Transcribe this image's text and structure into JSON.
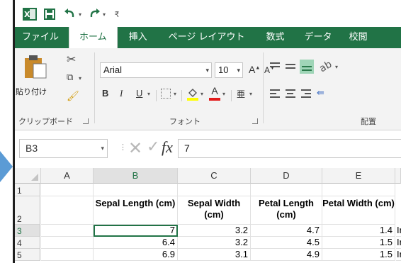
{
  "colors": {
    "accent": "#217346",
    "arrow": "#5b9bd5"
  },
  "quick_access": {
    "excel_icon": "excel-logo-icon",
    "save_icon": "save-icon",
    "undo_icon": "undo-icon",
    "redo_icon": "redo-icon",
    "customize_icon": "customize-quick-access-icon"
  },
  "tabs": [
    {
      "label": "ファイル"
    },
    {
      "label": "ホーム"
    },
    {
      "label": "挿入"
    },
    {
      "label": "ページ レイアウト"
    },
    {
      "label": "数式"
    },
    {
      "label": "データ"
    },
    {
      "label": "校閲"
    }
  ],
  "clipboard": {
    "paste_label": "貼り付け",
    "group_label": "クリップボード"
  },
  "font": {
    "name": "Arial",
    "size": "10",
    "group_label": "フォント",
    "bold": "B",
    "italic": "I",
    "underline": "U",
    "grow": "A",
    "shrink": "A",
    "font_color": "A",
    "phonetic": "亜"
  },
  "alignment": {
    "group_label": "配置"
  },
  "formula_bar": {
    "name_box": "B3",
    "fx": "fx",
    "value": "7"
  },
  "grid": {
    "columns": [
      "A",
      "B",
      "C",
      "D",
      "E"
    ],
    "rows": [
      "1",
      "2",
      "3",
      "4",
      "5"
    ],
    "headers": [
      "Sepal Length (cm)",
      "Sepal Width (cm)",
      "Petal Length (cm)",
      "Petal Width (cm)"
    ],
    "data": [
      [
        "7",
        "3.2",
        "4.7",
        "1.4",
        "Ir"
      ],
      [
        "6.4",
        "3.2",
        "4.5",
        "1.5",
        "Ir"
      ],
      [
        "6.9",
        "3.1",
        "4.9",
        "1.5",
        "Ir"
      ]
    ]
  }
}
